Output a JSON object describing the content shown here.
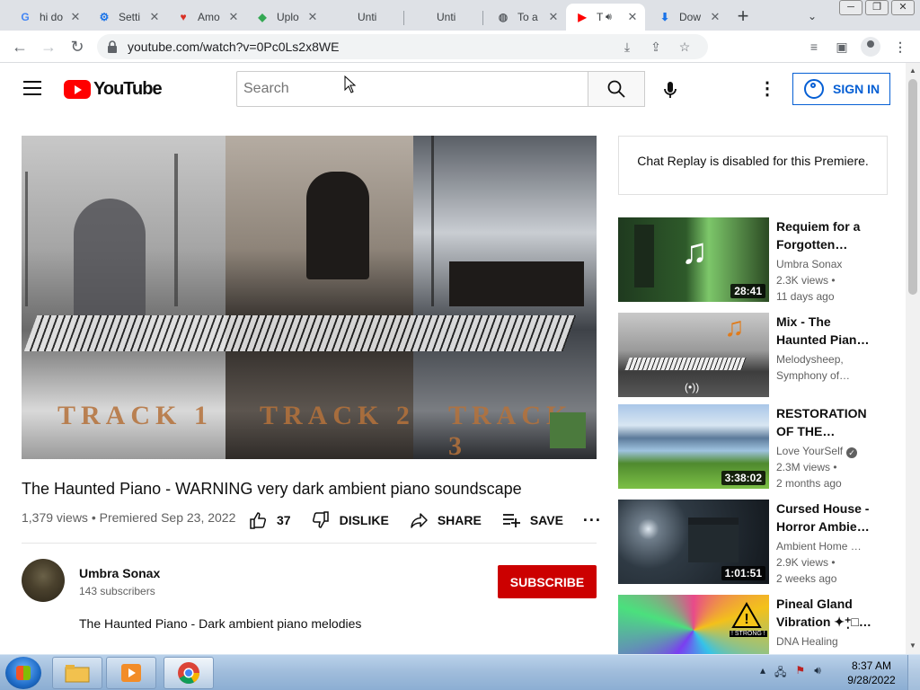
{
  "browser": {
    "tabs": [
      {
        "title": "hi do",
        "favicon": "G",
        "color": "#4285f4"
      },
      {
        "title": "Setti",
        "favicon": "⚙",
        "color": "#1a73e8"
      },
      {
        "title": "Amo",
        "favicon": "♥",
        "color": "#d93025"
      },
      {
        "title": "Uplo",
        "favicon": "◆",
        "color": "#34a853"
      },
      {
        "title": "Unti",
        "favicon": "",
        "color": "#5f6368"
      },
      {
        "title": "Unti",
        "favicon": "",
        "color": "#5f6368"
      },
      {
        "title": "To a",
        "favicon": "◍",
        "color": "#5f6368"
      },
      {
        "title": "T",
        "favicon": "▶",
        "color": "#ff0000"
      },
      {
        "title": "Dow",
        "favicon": "⬇",
        "color": "#1a73e8"
      }
    ],
    "url": "youtube.com/watch?v=0Pc0Ls2x8WE"
  },
  "youtube": {
    "logo_text": "YouTube",
    "search_placeholder": "Search",
    "sign_in": "SIGN IN"
  },
  "video": {
    "track_labels": [
      "TRACK 1",
      "TRACK 2",
      "TRACK 3"
    ],
    "title": "The Haunted Piano - WARNING very dark ambient piano soundscape",
    "meta": "1,379 views • Premiered Sep 23, 2022",
    "likes": "37",
    "dislike": "DISLIKE",
    "share": "SHARE",
    "save": "SAVE",
    "channel": "Umbra Sonax",
    "subscribers": "143 subscribers",
    "subscribe": "SUBSCRIBE",
    "description": "The Haunted Piano - Dark ambient piano melodies"
  },
  "chat": {
    "message": "Chat Replay is disabled for this Premiere."
  },
  "recommendations": [
    {
      "title": "Requiem for a Forgotten…",
      "channel": "Umbra Sonax",
      "line2": "2.3K views •",
      "line3": "11 days ago",
      "duration": "28:41"
    },
    {
      "title": "Mix - The Haunted Pian…",
      "channel": "Melodysheep,",
      "line2": "Symphony of…",
      "line3": "",
      "duration": "(•))"
    },
    {
      "title": "RESTORATION OF THE…",
      "channel": "Love YourSelf",
      "line2": "2.3M views •",
      "line3": "2 months ago",
      "duration": "3:38:02"
    },
    {
      "title": "Cursed House - Horror Ambie…",
      "channel": "Ambient Home …",
      "line2": "2.9K views •",
      "line3": "2 weeks ago",
      "duration": "1:01:51"
    },
    {
      "title": "Pineal Gland Vibration ✦⁺̣□…",
      "channel": "DNA Healing",
      "line2": "",
      "line3": "",
      "duration": "",
      "badge": "! STRONG !"
    }
  ],
  "taskbar": {
    "time": "8:37 AM",
    "date": "9/28/2022"
  },
  "colors": {
    "accent_blue": "#065fd4",
    "subscribe_red": "#cc0000",
    "youtube_red": "#ff0000"
  }
}
